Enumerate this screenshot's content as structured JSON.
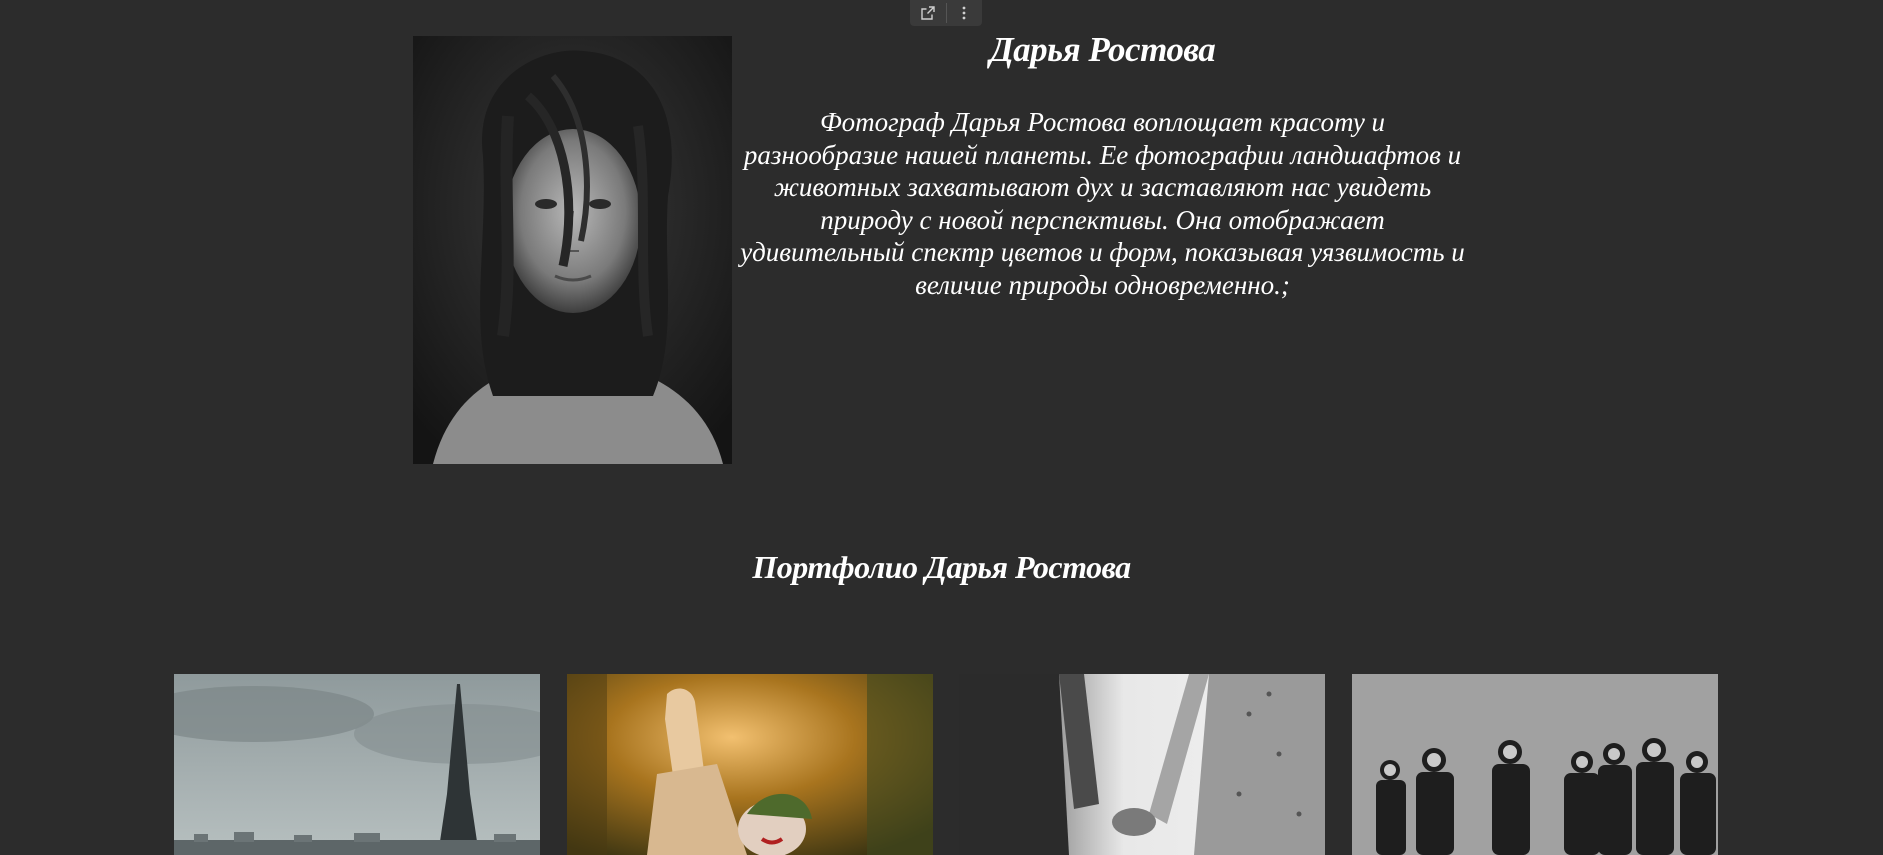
{
  "toolbar": {
    "open_icon": "external-link-icon",
    "more_icon": "more-vertical-icon"
  },
  "profile": {
    "name": "Дарья Ростова",
    "bio": "Фотограф Дарья Ростова воплощает красоту и разнообразие нашей планеты. Ее фотографии ландшафтов и животных захватывают дух и заставляют нас увидеть природу с новой перспективы. Она отображает удивительный спектр цветов и форм, показывая уязвимость и величие природы одновременно.;",
    "portrait_image": "black-and-white-portrait-of-woman"
  },
  "portfolio": {
    "title": "Портфолио Дарья Ростова",
    "items": [
      {
        "image": "eiffel-tower-cloudy-sky"
      },
      {
        "image": "clown-raising-hand-golden-light"
      },
      {
        "image": "couple-holding-hands-bw"
      },
      {
        "image": "band-group-photo-bw"
      }
    ]
  },
  "colors": {
    "background": "#2c2c2c",
    "text": "#ffffff",
    "toolbar": "#3a3a3a"
  }
}
